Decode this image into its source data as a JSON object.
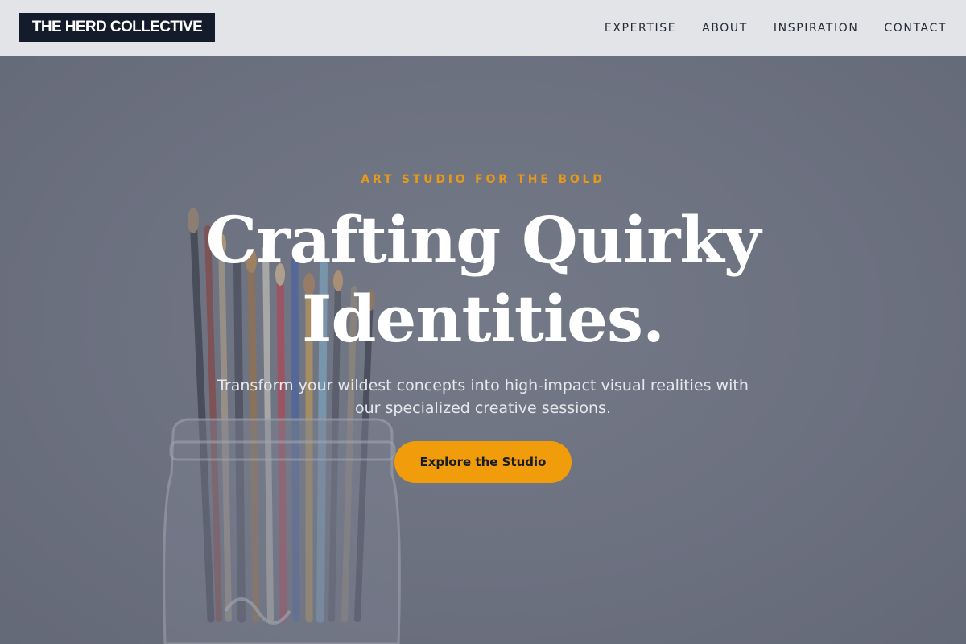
{
  "brand": {
    "name": "THE HERD COLLECTIVE"
  },
  "nav": {
    "items": [
      {
        "label": "EXPERTISE"
      },
      {
        "label": "ABOUT"
      },
      {
        "label": "INSPIRATION"
      },
      {
        "label": "CONTACT"
      }
    ]
  },
  "hero": {
    "eyebrow": "ART STUDIO FOR THE BOLD",
    "headline_line1": "Crafting Quirky",
    "headline_line2": "Identities.",
    "subtitle": "Transform your wildest concepts into high-impact visual realities with our specialized creative sessions.",
    "cta_label": "Explore the Studio"
  },
  "colors": {
    "nav_bg": "#e3e4e7",
    "logo_bg": "#141b2b",
    "accent": "#f09c0b",
    "hero_overlay": "#6b7080"
  }
}
